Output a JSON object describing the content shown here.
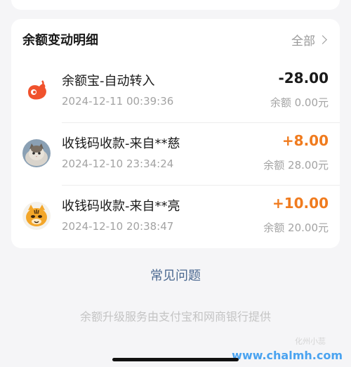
{
  "section": {
    "title": "余额变动明细",
    "see_all_label": "全部"
  },
  "transactions": [
    {
      "title": "余额宝-自动转入",
      "time": "2024-12-11 00:39:36",
      "amount": "-28.00",
      "balance": "余额 0.00元",
      "avatar_icon": "yuebao-logo-icon",
      "amount_color": "#1a1a1a"
    },
    {
      "title": "收钱码收款-来自**慈",
      "time": "2024-12-10 23:34:24",
      "amount": "+8.00",
      "balance": "余额 28.00元",
      "avatar_icon": "cat-photo-avatar",
      "amount_color": "#f07b1e"
    },
    {
      "title": "收钱码收款-来自**亮",
      "time": "2024-12-10 20:38:47",
      "amount": "+10.00",
      "balance": "余额 20.00元",
      "avatar_icon": "tiger-cartoon-avatar",
      "amount_color": "#f07b1e"
    }
  ],
  "faq_label": "常见问题",
  "footer_text": "余额升级服务由支付宝和网商银行提供",
  "watermark": {
    "text": "www.chalmh.com",
    "sub_text": "化州小蕊"
  }
}
